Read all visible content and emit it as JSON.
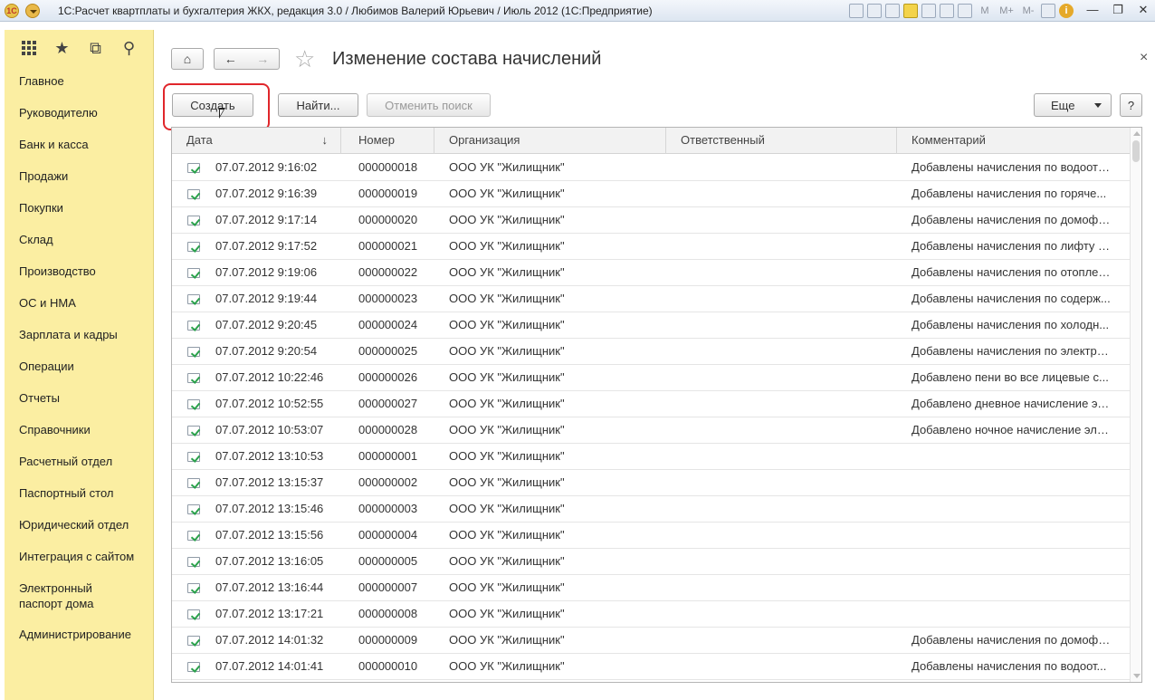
{
  "window": {
    "title": "1С:Расчет квартплаты и бухгалтерия ЖКХ, редакция 3.0 / Любимов Валерий Юрьевич / Июль 2012  (1С:Предприятие)",
    "logo_text": "1С",
    "toolbar_text": [
      "M",
      "M+",
      "M-"
    ],
    "info_text": "i",
    "minimize": "—",
    "restore": "❐",
    "close": "✕"
  },
  "sidebar": {
    "items": [
      {
        "label": "Главное"
      },
      {
        "label": "Руководителю"
      },
      {
        "label": "Банк и касса"
      },
      {
        "label": "Продажи"
      },
      {
        "label": "Покупки"
      },
      {
        "label": "Склад"
      },
      {
        "label": "Производство"
      },
      {
        "label": "ОС и НМА"
      },
      {
        "label": "Зарплата и кадры"
      },
      {
        "label": "Операции"
      },
      {
        "label": "Отчеты"
      },
      {
        "label": "Справочники"
      },
      {
        "label": "Расчетный отдел"
      },
      {
        "label": "Паспортный стол"
      },
      {
        "label": "Юридический отдел"
      },
      {
        "label": "Интеграция с сайтом"
      },
      {
        "label": "Электронный паспорт дома"
      },
      {
        "label": "Администрирование"
      }
    ]
  },
  "header": {
    "title": "Изменение состава начислений",
    "home_glyph": "⌂",
    "back_glyph": "←",
    "forward_glyph": "→",
    "star_glyph": "☆",
    "close_glyph": "×"
  },
  "commands": {
    "create": "Создать",
    "find": "Найти...",
    "cancel_search": "Отменить поиск",
    "more": "Еще",
    "help": "?"
  },
  "table": {
    "columns": {
      "date": "Дата",
      "number": "Номер",
      "organization": "Организация",
      "responsible": "Ответственный",
      "comment": "Комментарий"
    },
    "sort_glyph": "↓",
    "rows": [
      {
        "date": "07.07.2012 9:16:02",
        "number": "000000018",
        "org": "ООО УК \"Жилищник\"",
        "resp": "",
        "comment": "Добавлены начисления по водоотв..."
      },
      {
        "date": "07.07.2012 9:16:39",
        "number": "000000019",
        "org": "ООО УК \"Жилищник\"",
        "resp": "",
        "comment": "Добавлены начисления по горяче..."
      },
      {
        "date": "07.07.2012 9:17:14",
        "number": "000000020",
        "org": "ООО УК \"Жилищник\"",
        "resp": "",
        "comment": "Добавлены начисления по домофо..."
      },
      {
        "date": "07.07.2012 9:17:52",
        "number": "000000021",
        "org": "ООО УК \"Жилищник\"",
        "resp": "",
        "comment": "Добавлены начисления по лифту п..."
      },
      {
        "date": "07.07.2012 9:19:06",
        "number": "000000022",
        "org": "ООО УК \"Жилищник\"",
        "resp": "",
        "comment": "Добавлены начисления по отоплен..."
      },
      {
        "date": "07.07.2012 9:19:44",
        "number": "000000023",
        "org": "ООО УК \"Жилищник\"",
        "resp": "",
        "comment": "Добавлены начисления по содерж..."
      },
      {
        "date": "07.07.2012 9:20:45",
        "number": "000000024",
        "org": "ООО УК \"Жилищник\"",
        "resp": "",
        "comment": "Добавлены начисления по  холодн..."
      },
      {
        "date": "07.07.2012 9:20:54",
        "number": "000000025",
        "org": "ООО УК \"Жилищник\"",
        "resp": "",
        "comment": "Добавлены начисления по электро..."
      },
      {
        "date": "07.07.2012 10:22:46",
        "number": "000000026",
        "org": "ООО УК \"Жилищник\"",
        "resp": "",
        "comment": "Добавлено пени во все лицевые с..."
      },
      {
        "date": "07.07.2012 10:52:55",
        "number": "000000027",
        "org": "ООО УК \"Жилищник\"",
        "resp": "",
        "comment": "Добавлено дневное начисление эл..."
      },
      {
        "date": "07.07.2012 10:53:07",
        "number": "000000028",
        "org": "ООО УК \"Жилищник\"",
        "resp": "",
        "comment": "Добавлено ночное начисление эле..."
      },
      {
        "date": "07.07.2012 13:10:53",
        "number": "000000001",
        "org": "ООО УК \"Жилищник\"",
        "resp": "",
        "comment": ""
      },
      {
        "date": "07.07.2012 13:15:37",
        "number": "000000002",
        "org": "ООО УК \"Жилищник\"",
        "resp": "",
        "comment": ""
      },
      {
        "date": "07.07.2012 13:15:46",
        "number": "000000003",
        "org": "ООО УК \"Жилищник\"",
        "resp": "",
        "comment": ""
      },
      {
        "date": "07.07.2012 13:15:56",
        "number": "000000004",
        "org": "ООО УК \"Жилищник\"",
        "resp": "",
        "comment": ""
      },
      {
        "date": "07.07.2012 13:16:05",
        "number": "000000005",
        "org": "ООО УК \"Жилищник\"",
        "resp": "",
        "comment": ""
      },
      {
        "date": "07.07.2012 13:16:44",
        "number": "000000007",
        "org": "ООО УК \"Жилищник\"",
        "resp": "",
        "comment": ""
      },
      {
        "date": "07.07.2012 13:17:21",
        "number": "000000008",
        "org": "ООО УК \"Жилищник\"",
        "resp": "",
        "comment": ""
      },
      {
        "date": "07.07.2012 14:01:32",
        "number": "000000009",
        "org": "ООО УК \"Жилищник\"",
        "resp": "",
        "comment": "Добавлены начисления по домофо..."
      },
      {
        "date": "07.07.2012 14:01:41",
        "number": "000000010",
        "org": "ООО УК \"Жилищник\"",
        "resp": "",
        "comment": "Добавлены начисления по  водоот..."
      }
    ]
  },
  "colors": {
    "sidebar_bg": "#fbeea2",
    "highlight": "#e0262b",
    "posted_check": "#2aa14b"
  }
}
